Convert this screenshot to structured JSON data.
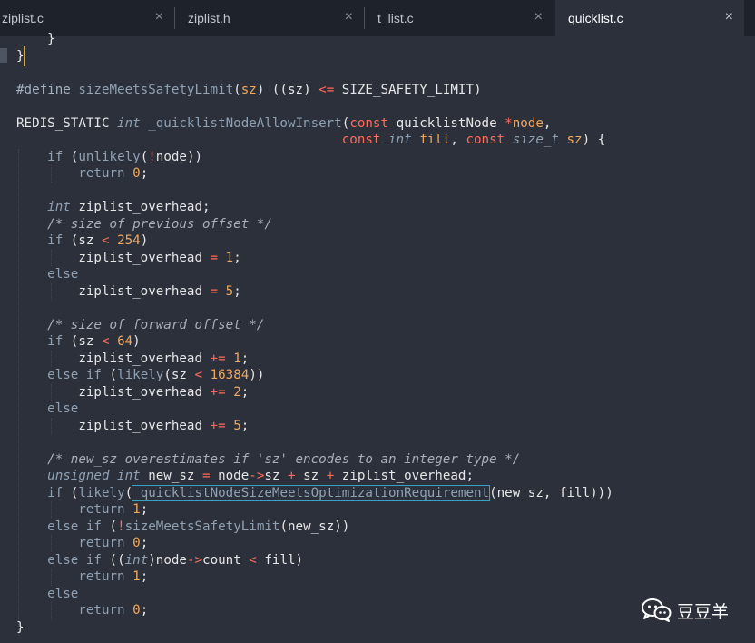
{
  "tabs": [
    {
      "label": "ziplist.c",
      "close": "×",
      "active": false
    },
    {
      "label": "ziplist.h",
      "close": "×",
      "active": false
    },
    {
      "label": "t_list.c",
      "close": "×",
      "active": false
    },
    {
      "label": "quicklist.c",
      "close": "×",
      "active": true
    }
  ],
  "code_lines": [
    [
      {
        "t": "    }",
        "c": ""
      }
    ],
    [
      {
        "t": "}",
        "c": ""
      }
    ],
    [],
    [
      {
        "t": "#define ",
        "c": "mac"
      },
      {
        "t": "sizeMeetsSafetyLimit",
        "c": "fn"
      },
      {
        "t": "(",
        "c": ""
      },
      {
        "t": "sz",
        "c": "num"
      },
      {
        "t": ") ((sz) ",
        "c": ""
      },
      {
        "t": "<=",
        "c": "op"
      },
      {
        "t": " SIZE_SAFETY_LIMIT)",
        "c": ""
      }
    ],
    [],
    [
      {
        "t": "REDIS_STATIC ",
        "c": ""
      },
      {
        "t": "int",
        "c": "ty"
      },
      {
        "t": " ",
        "c": ""
      },
      {
        "t": "_quicklistNodeAllowInsert",
        "c": "fn"
      },
      {
        "t": "(",
        "c": ""
      },
      {
        "t": "const",
        "c": "op"
      },
      {
        "t": " quicklistNode ",
        "c": ""
      },
      {
        "t": "*",
        "c": "op"
      },
      {
        "t": "node",
        "c": "num"
      },
      {
        "t": ",",
        "c": ""
      }
    ],
    [
      {
        "t": "                                          ",
        "c": ""
      },
      {
        "t": "const",
        "c": "op"
      },
      {
        "t": " ",
        "c": ""
      },
      {
        "t": "int",
        "c": "ty"
      },
      {
        "t": " ",
        "c": ""
      },
      {
        "t": "fill",
        "c": "num"
      },
      {
        "t": ", ",
        "c": ""
      },
      {
        "t": "const",
        "c": "op"
      },
      {
        "t": " ",
        "c": ""
      },
      {
        "t": "size_t",
        "c": "ty"
      },
      {
        "t": " ",
        "c": ""
      },
      {
        "t": "sz",
        "c": "num"
      },
      {
        "t": ") {",
        "c": ""
      }
    ],
    [
      {
        "t": "    ",
        "c": ""
      },
      {
        "t": "if",
        "c": "kw"
      },
      {
        "t": " (",
        "c": ""
      },
      {
        "t": "unlikely",
        "c": "fn"
      },
      {
        "t": "(",
        "c": ""
      },
      {
        "t": "!",
        "c": "op"
      },
      {
        "t": "node))",
        "c": ""
      }
    ],
    [
      {
        "t": "        ",
        "c": ""
      },
      {
        "t": "return",
        "c": "kw"
      },
      {
        "t": " ",
        "c": ""
      },
      {
        "t": "0",
        "c": "num"
      },
      {
        "t": ";",
        "c": ""
      }
    ],
    [],
    [
      {
        "t": "    ",
        "c": ""
      },
      {
        "t": "int",
        "c": "ty"
      },
      {
        "t": " ziplist_overhead;",
        "c": ""
      }
    ],
    [
      {
        "t": "    ",
        "c": ""
      },
      {
        "t": "/* size of previous offset */",
        "c": "cm"
      }
    ],
    [
      {
        "t": "    ",
        "c": ""
      },
      {
        "t": "if",
        "c": "kw"
      },
      {
        "t": " (sz ",
        "c": ""
      },
      {
        "t": "<",
        "c": "op"
      },
      {
        "t": " ",
        "c": ""
      },
      {
        "t": "254",
        "c": "num"
      },
      {
        "t": ")",
        "c": ""
      }
    ],
    [
      {
        "t": "        ziplist_overhead ",
        "c": ""
      },
      {
        "t": "=",
        "c": "op"
      },
      {
        "t": " ",
        "c": ""
      },
      {
        "t": "1",
        "c": "num"
      },
      {
        "t": ";",
        "c": ""
      }
    ],
    [
      {
        "t": "    ",
        "c": ""
      },
      {
        "t": "else",
        "c": "kw"
      }
    ],
    [
      {
        "t": "        ziplist_overhead ",
        "c": ""
      },
      {
        "t": "=",
        "c": "op"
      },
      {
        "t": " ",
        "c": ""
      },
      {
        "t": "5",
        "c": "num"
      },
      {
        "t": ";",
        "c": ""
      }
    ],
    [],
    [
      {
        "t": "    ",
        "c": ""
      },
      {
        "t": "/* size of forward offset */",
        "c": "cm"
      }
    ],
    [
      {
        "t": "    ",
        "c": ""
      },
      {
        "t": "if",
        "c": "kw"
      },
      {
        "t": " (sz ",
        "c": ""
      },
      {
        "t": "<",
        "c": "op"
      },
      {
        "t": " ",
        "c": ""
      },
      {
        "t": "64",
        "c": "num"
      },
      {
        "t": ")",
        "c": ""
      }
    ],
    [
      {
        "t": "        ziplist_overhead ",
        "c": ""
      },
      {
        "t": "+=",
        "c": "op"
      },
      {
        "t": " ",
        "c": ""
      },
      {
        "t": "1",
        "c": "num"
      },
      {
        "t": ";",
        "c": ""
      }
    ],
    [
      {
        "t": "    ",
        "c": ""
      },
      {
        "t": "else",
        "c": "kw"
      },
      {
        "t": " ",
        "c": ""
      },
      {
        "t": "if",
        "c": "kw"
      },
      {
        "t": " (",
        "c": ""
      },
      {
        "t": "likely",
        "c": "fn"
      },
      {
        "t": "(sz ",
        "c": ""
      },
      {
        "t": "<",
        "c": "op"
      },
      {
        "t": " ",
        "c": ""
      },
      {
        "t": "16384",
        "c": "num"
      },
      {
        "t": "))",
        "c": ""
      }
    ],
    [
      {
        "t": "        ziplist_overhead ",
        "c": ""
      },
      {
        "t": "+=",
        "c": "op"
      },
      {
        "t": " ",
        "c": ""
      },
      {
        "t": "2",
        "c": "num"
      },
      {
        "t": ";",
        "c": ""
      }
    ],
    [
      {
        "t": "    ",
        "c": ""
      },
      {
        "t": "else",
        "c": "kw"
      }
    ],
    [
      {
        "t": "        ziplist_overhead ",
        "c": ""
      },
      {
        "t": "+=",
        "c": "op"
      },
      {
        "t": " ",
        "c": ""
      },
      {
        "t": "5",
        "c": "num"
      },
      {
        "t": ";",
        "c": ""
      }
    ],
    [],
    [
      {
        "t": "    ",
        "c": ""
      },
      {
        "t": "/* new_sz overestimates if 'sz' encodes to an integer type */",
        "c": "cm"
      }
    ],
    [
      {
        "t": "    ",
        "c": ""
      },
      {
        "t": "unsigned int",
        "c": "ty"
      },
      {
        "t": " new_sz ",
        "c": ""
      },
      {
        "t": "=",
        "c": "op"
      },
      {
        "t": " node",
        "c": ""
      },
      {
        "t": "->",
        "c": "op"
      },
      {
        "t": "sz ",
        "c": ""
      },
      {
        "t": "+",
        "c": "op"
      },
      {
        "t": " sz ",
        "c": ""
      },
      {
        "t": "+",
        "c": "op"
      },
      {
        "t": " ziplist_overhead;",
        "c": ""
      }
    ],
    [
      {
        "t": "    ",
        "c": ""
      },
      {
        "t": "if",
        "c": "kw"
      },
      {
        "t": " (",
        "c": ""
      },
      {
        "t": "likely",
        "c": "fn"
      },
      {
        "t": "(",
        "c": ""
      },
      {
        "t": "_quicklistNodeSizeMeetsOptimizationRequirement",
        "c": "boxed"
      },
      {
        "t": "(new_sz, fill)))",
        "c": ""
      }
    ],
    [
      {
        "t": "        ",
        "c": ""
      },
      {
        "t": "return",
        "c": "kw"
      },
      {
        "t": " ",
        "c": ""
      },
      {
        "t": "1",
        "c": "num"
      },
      {
        "t": ";",
        "c": ""
      }
    ],
    [
      {
        "t": "    ",
        "c": ""
      },
      {
        "t": "else",
        "c": "kw"
      },
      {
        "t": " ",
        "c": ""
      },
      {
        "t": "if",
        "c": "kw"
      },
      {
        "t": " (",
        "c": ""
      },
      {
        "t": "!",
        "c": "op"
      },
      {
        "t": "sizeMeetsSafetyLimit",
        "c": "fn"
      },
      {
        "t": "(new_sz))",
        "c": ""
      }
    ],
    [
      {
        "t": "        ",
        "c": ""
      },
      {
        "t": "return",
        "c": "kw"
      },
      {
        "t": " ",
        "c": ""
      },
      {
        "t": "0",
        "c": "num"
      },
      {
        "t": ";",
        "c": ""
      }
    ],
    [
      {
        "t": "    ",
        "c": ""
      },
      {
        "t": "else",
        "c": "kw"
      },
      {
        "t": " ",
        "c": ""
      },
      {
        "t": "if",
        "c": "kw"
      },
      {
        "t": " ((",
        "c": ""
      },
      {
        "t": "int",
        "c": "ty"
      },
      {
        "t": ")node",
        "c": ""
      },
      {
        "t": "->",
        "c": "op"
      },
      {
        "t": "count ",
        "c": ""
      },
      {
        "t": "<",
        "c": "op"
      },
      {
        "t": " fill)",
        "c": ""
      }
    ],
    [
      {
        "t": "        ",
        "c": ""
      },
      {
        "t": "return",
        "c": "kw"
      },
      {
        "t": " ",
        "c": ""
      },
      {
        "t": "1",
        "c": "num"
      },
      {
        "t": ";",
        "c": ""
      }
    ],
    [
      {
        "t": "    ",
        "c": ""
      },
      {
        "t": "else",
        "c": "kw"
      }
    ],
    [
      {
        "t": "        ",
        "c": ""
      },
      {
        "t": "return",
        "c": "kw"
      },
      {
        "t": " ",
        "c": ""
      },
      {
        "t": "0",
        "c": "num"
      },
      {
        "t": ";",
        "c": ""
      }
    ],
    [
      {
        "t": "}",
        "c": ""
      }
    ]
  ],
  "watermark": {
    "text": "豆豆羊",
    "icon": "wechat-icon"
  },
  "colors": {
    "editor_bg": "#2b303b",
    "tabbar_bg": "#1e222a",
    "operator": "#ff6b5a",
    "number": "#f0a85e",
    "keyword": "#8fa1b3",
    "comment": "#a8adb6",
    "cursor": "#d8a640",
    "match_highlight": "#3aa1c9"
  }
}
